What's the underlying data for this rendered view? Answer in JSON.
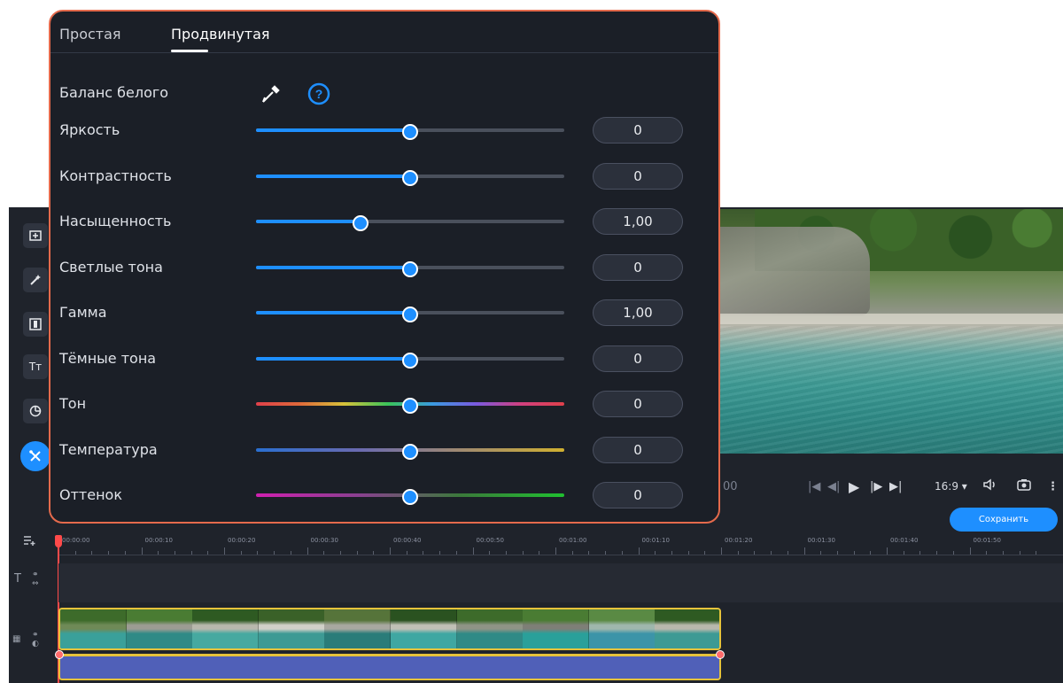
{
  "panel": {
    "tabs": [
      "Простая",
      "Продвинутая"
    ],
    "active_tab": "Продвинутая",
    "white_balance_label": "Баланс белого",
    "rows": [
      {
        "label": "Яркость",
        "value": "0",
        "level": 0.5,
        "track": "blue"
      },
      {
        "label": "Контрастность",
        "value": "0",
        "level": 0.5,
        "track": "blue"
      },
      {
        "label": "Насыщенность",
        "value": "1,00",
        "level": 0.34,
        "track": "blue"
      },
      {
        "label": "Светлые тона",
        "value": "0",
        "level": 0.5,
        "track": "blue"
      },
      {
        "label": "Гамма",
        "value": "1,00",
        "level": 0.5,
        "track": "blue"
      },
      {
        "label": "Тёмные тона",
        "value": "0",
        "level": 0.5,
        "track": "blue"
      },
      {
        "label": "Тон",
        "value": "0",
        "level": 0.5,
        "track": "rainbow"
      },
      {
        "label": "Температура",
        "value": "0",
        "level": 0.5,
        "track": "temp"
      },
      {
        "label": "Оттенок",
        "value": "0",
        "level": 0.5,
        "track": "tint"
      }
    ]
  },
  "player": {
    "time_fragment": "00",
    "aspect_ratio": "16:9 ▾"
  },
  "save_label": "Сохранить",
  "timeline": {
    "ticks": [
      "00:00:00",
      "00:00:10",
      "00:00:20",
      "00:00:30",
      "00:00:40",
      "00:00:50",
      "00:01:00",
      "00:01:10",
      "00:01:20",
      "00:01:30",
      "00:01:40",
      "00:01:50"
    ]
  },
  "colors": {
    "accent": "#1e8fff",
    "panel_border": "#e46a4c",
    "clip_border": "#e6c33b",
    "background": "#1b1f27"
  },
  "icons": {
    "toolbar": [
      "import-icon",
      "magic-wand-icon",
      "transitions-icon",
      "titles-icon",
      "stickers-icon",
      "tools-icon"
    ]
  }
}
